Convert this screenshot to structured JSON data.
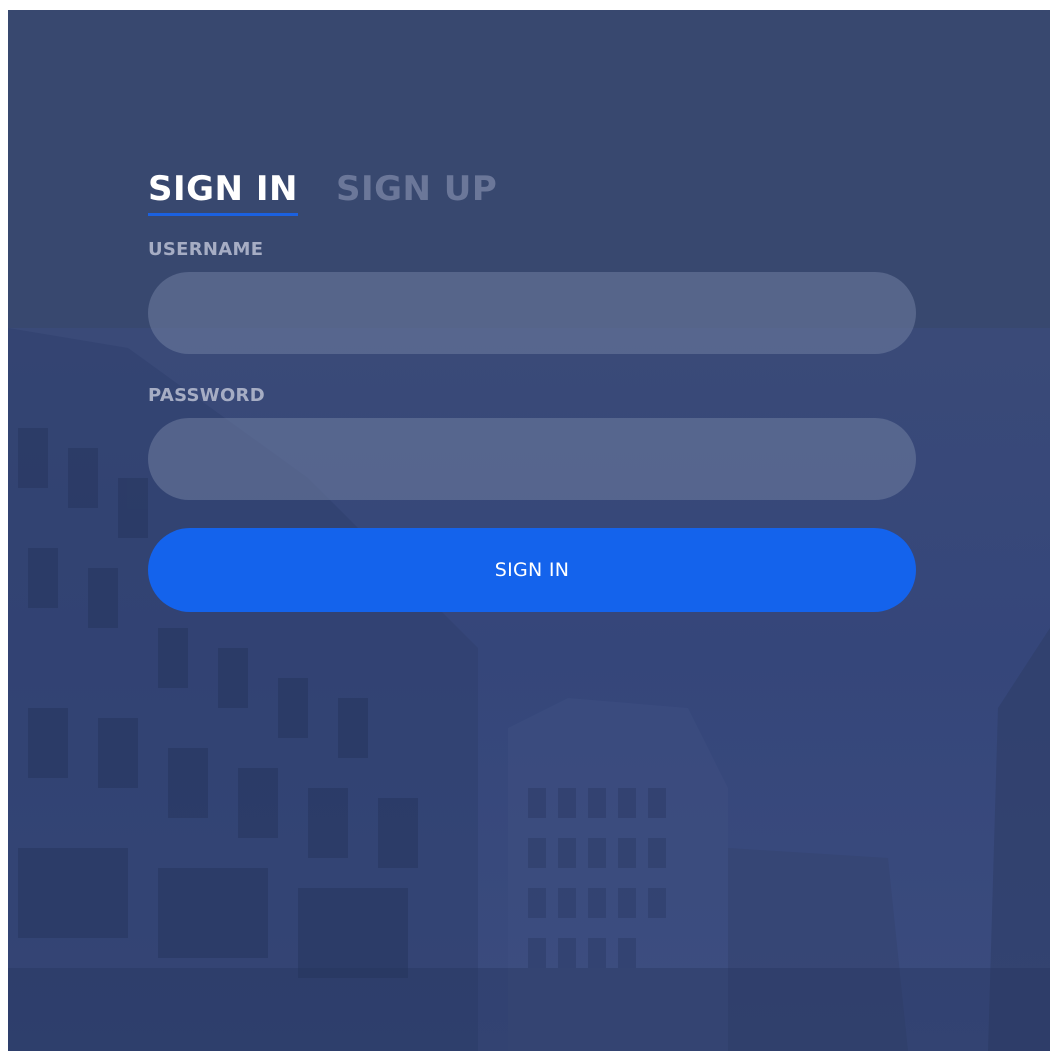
{
  "tabs": {
    "signin_label": "SIGN IN",
    "signup_label": "SIGN UP"
  },
  "form": {
    "username_label": "USERNAME",
    "username_value": "",
    "password_label": "PASSWORD",
    "password_value": "",
    "submit_label": "SIGN IN"
  },
  "colors": {
    "accent": "#1463ec",
    "background": "#364774"
  }
}
